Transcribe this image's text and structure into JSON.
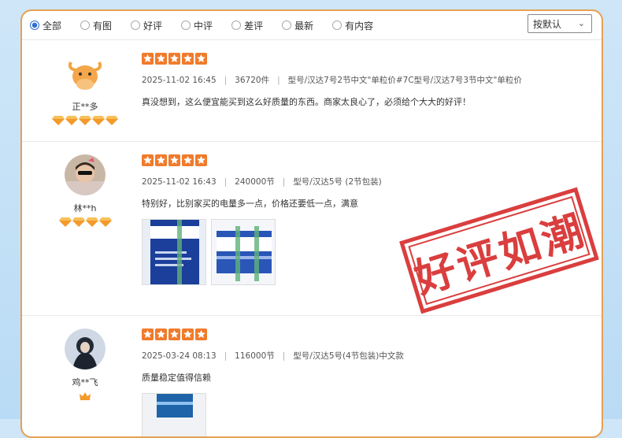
{
  "filters": {
    "options": [
      "全部",
      "有图",
      "好评",
      "中评",
      "差评",
      "最新",
      "有内容"
    ],
    "sort_label": "按默认"
  },
  "reviews": [
    {
      "user": "正**多",
      "rating": 5,
      "date": "2025-11-02 16:45",
      "qty": "36720件",
      "variant": "型号/汉达7号2节中文\"单粒价#7C型号/汉达7号3节中文\"单粒价",
      "text": "真没想到，这么便宜能买到这么好质量的东西。商家太良心了，必须给个大大的好评！",
      "gems": 5
    },
    {
      "user": "林**h",
      "rating": 5,
      "date": "2025-11-02 16:43",
      "qty": "240000节",
      "variant": "型号/汉达5号 (2节包装)",
      "text": "特别好，比别家买的电量多一点，价格还要低一点，满意",
      "gems": 4
    },
    {
      "user": "鸡**飞",
      "rating": 5,
      "date": "2025-03-24 08:13",
      "qty": "116000节",
      "variant": "型号/汉达5号(4节包装)中文款",
      "text": "质量稳定值得信赖",
      "gems": 1
    }
  ],
  "stamp": "好评如潮",
  "colors": {
    "accent": "#e3a155",
    "star": "#f07b2c",
    "stamp": "#d72a2a",
    "radio": "#2f6fd6"
  }
}
